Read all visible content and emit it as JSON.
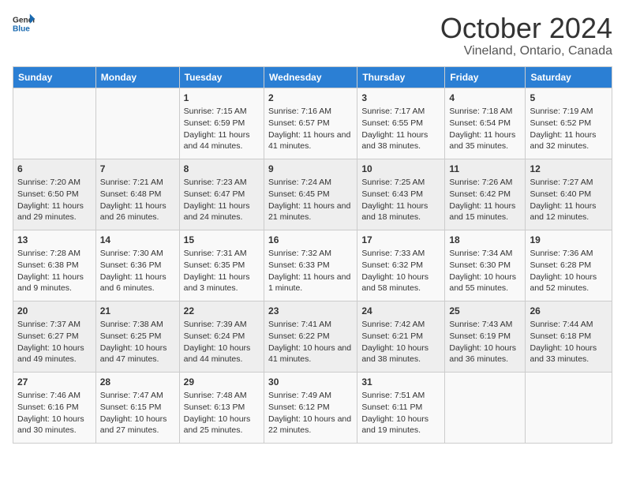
{
  "logo": {
    "line1": "General",
    "line2": "Blue"
  },
  "title": "October 2024",
  "subtitle": "Vineland, Ontario, Canada",
  "days_of_week": [
    "Sunday",
    "Monday",
    "Tuesday",
    "Wednesday",
    "Thursday",
    "Friday",
    "Saturday"
  ],
  "weeks": [
    [
      {
        "num": "",
        "info": ""
      },
      {
        "num": "",
        "info": ""
      },
      {
        "num": "1",
        "info": "Sunrise: 7:15 AM\nSunset: 6:59 PM\nDaylight: 11 hours and 44 minutes."
      },
      {
        "num": "2",
        "info": "Sunrise: 7:16 AM\nSunset: 6:57 PM\nDaylight: 11 hours and 41 minutes."
      },
      {
        "num": "3",
        "info": "Sunrise: 7:17 AM\nSunset: 6:55 PM\nDaylight: 11 hours and 38 minutes."
      },
      {
        "num": "4",
        "info": "Sunrise: 7:18 AM\nSunset: 6:54 PM\nDaylight: 11 hours and 35 minutes."
      },
      {
        "num": "5",
        "info": "Sunrise: 7:19 AM\nSunset: 6:52 PM\nDaylight: 11 hours and 32 minutes."
      }
    ],
    [
      {
        "num": "6",
        "info": "Sunrise: 7:20 AM\nSunset: 6:50 PM\nDaylight: 11 hours and 29 minutes."
      },
      {
        "num": "7",
        "info": "Sunrise: 7:21 AM\nSunset: 6:48 PM\nDaylight: 11 hours and 26 minutes."
      },
      {
        "num": "8",
        "info": "Sunrise: 7:23 AM\nSunset: 6:47 PM\nDaylight: 11 hours and 24 minutes."
      },
      {
        "num": "9",
        "info": "Sunrise: 7:24 AM\nSunset: 6:45 PM\nDaylight: 11 hours and 21 minutes."
      },
      {
        "num": "10",
        "info": "Sunrise: 7:25 AM\nSunset: 6:43 PM\nDaylight: 11 hours and 18 minutes."
      },
      {
        "num": "11",
        "info": "Sunrise: 7:26 AM\nSunset: 6:42 PM\nDaylight: 11 hours and 15 minutes."
      },
      {
        "num": "12",
        "info": "Sunrise: 7:27 AM\nSunset: 6:40 PM\nDaylight: 11 hours and 12 minutes."
      }
    ],
    [
      {
        "num": "13",
        "info": "Sunrise: 7:28 AM\nSunset: 6:38 PM\nDaylight: 11 hours and 9 minutes."
      },
      {
        "num": "14",
        "info": "Sunrise: 7:30 AM\nSunset: 6:36 PM\nDaylight: 11 hours and 6 minutes."
      },
      {
        "num": "15",
        "info": "Sunrise: 7:31 AM\nSunset: 6:35 PM\nDaylight: 11 hours and 3 minutes."
      },
      {
        "num": "16",
        "info": "Sunrise: 7:32 AM\nSunset: 6:33 PM\nDaylight: 11 hours and 1 minute."
      },
      {
        "num": "17",
        "info": "Sunrise: 7:33 AM\nSunset: 6:32 PM\nDaylight: 10 hours and 58 minutes."
      },
      {
        "num": "18",
        "info": "Sunrise: 7:34 AM\nSunset: 6:30 PM\nDaylight: 10 hours and 55 minutes."
      },
      {
        "num": "19",
        "info": "Sunrise: 7:36 AM\nSunset: 6:28 PM\nDaylight: 10 hours and 52 minutes."
      }
    ],
    [
      {
        "num": "20",
        "info": "Sunrise: 7:37 AM\nSunset: 6:27 PM\nDaylight: 10 hours and 49 minutes."
      },
      {
        "num": "21",
        "info": "Sunrise: 7:38 AM\nSunset: 6:25 PM\nDaylight: 10 hours and 47 minutes."
      },
      {
        "num": "22",
        "info": "Sunrise: 7:39 AM\nSunset: 6:24 PM\nDaylight: 10 hours and 44 minutes."
      },
      {
        "num": "23",
        "info": "Sunrise: 7:41 AM\nSunset: 6:22 PM\nDaylight: 10 hours and 41 minutes."
      },
      {
        "num": "24",
        "info": "Sunrise: 7:42 AM\nSunset: 6:21 PM\nDaylight: 10 hours and 38 minutes."
      },
      {
        "num": "25",
        "info": "Sunrise: 7:43 AM\nSunset: 6:19 PM\nDaylight: 10 hours and 36 minutes."
      },
      {
        "num": "26",
        "info": "Sunrise: 7:44 AM\nSunset: 6:18 PM\nDaylight: 10 hours and 33 minutes."
      }
    ],
    [
      {
        "num": "27",
        "info": "Sunrise: 7:46 AM\nSunset: 6:16 PM\nDaylight: 10 hours and 30 minutes."
      },
      {
        "num": "28",
        "info": "Sunrise: 7:47 AM\nSunset: 6:15 PM\nDaylight: 10 hours and 27 minutes."
      },
      {
        "num": "29",
        "info": "Sunrise: 7:48 AM\nSunset: 6:13 PM\nDaylight: 10 hours and 25 minutes."
      },
      {
        "num": "30",
        "info": "Sunrise: 7:49 AM\nSunset: 6:12 PM\nDaylight: 10 hours and 22 minutes."
      },
      {
        "num": "31",
        "info": "Sunrise: 7:51 AM\nSunset: 6:11 PM\nDaylight: 10 hours and 19 minutes."
      },
      {
        "num": "",
        "info": ""
      },
      {
        "num": "",
        "info": ""
      }
    ]
  ]
}
